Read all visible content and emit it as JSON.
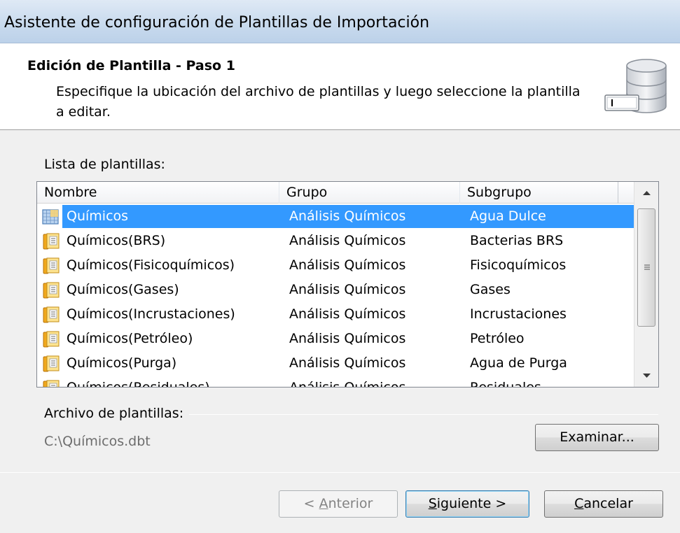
{
  "window": {
    "title": "Asistente de configuración de Plantillas de Importación"
  },
  "header": {
    "title": "Edición de Plantilla - Paso 1",
    "description": "Especifique la ubicación del archivo de plantillas y luego seleccione la plantilla a editar."
  },
  "list": {
    "label": "Lista de plantillas:",
    "columns": [
      "Nombre",
      "Grupo",
      "Subgrupo"
    ],
    "rows": [
      {
        "name": "Químicos",
        "group": "Análisis Químicos",
        "subgroup": "Agua Dulce",
        "selected": true
      },
      {
        "name": "Químicos(BRS)",
        "group": "Análisis Químicos",
        "subgroup": "Bacterias BRS"
      },
      {
        "name": "Químicos(Fisicoquímicos)",
        "group": "Análisis Químicos",
        "subgroup": "Fisicoquímicos"
      },
      {
        "name": "Químicos(Gases)",
        "group": "Análisis Químicos",
        "subgroup": "Gases"
      },
      {
        "name": "Químicos(Incrustaciones)",
        "group": "Análisis Químicos",
        "subgroup": "Incrustaciones"
      },
      {
        "name": "Químicos(Petróleo)",
        "group": "Análisis Químicos",
        "subgroup": "Petróleo"
      },
      {
        "name": "Químicos(Purga)",
        "group": "Análisis Químicos",
        "subgroup": "Agua de Purga"
      },
      {
        "name": "Químicos(Residuales)",
        "group": "Análisis Químicos",
        "subgroup": "Residuales"
      }
    ]
  },
  "file": {
    "label": "Archivo de plantillas:",
    "path": "C:\\Químicos.dbt",
    "browse_label": "Examinar..."
  },
  "buttons": {
    "back_prefix": "< ",
    "back_mnemonic": "A",
    "back_rest": "nterior",
    "next_mnemonic": "S",
    "next_rest": "iguiente >",
    "cancel_mnemonic": "C",
    "cancel_rest": "ancelar"
  },
  "colors": {
    "selection": "#3399ff",
    "title_bar": "#c9dbee"
  },
  "icons": {
    "header": "database-icon",
    "selected_row": "grid-table-icon",
    "row": "template-book-icon"
  }
}
